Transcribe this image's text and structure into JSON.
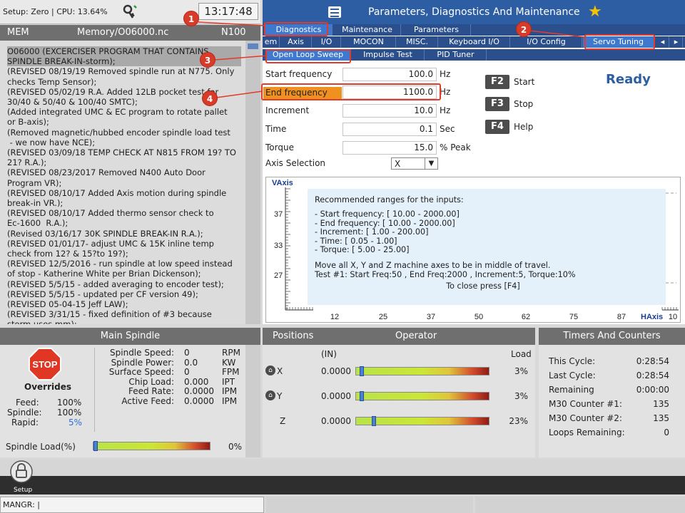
{
  "status": {
    "text": "Setup: Zero | CPU: 13.64%",
    "clock": "13:17:48"
  },
  "program": {
    "mode": "MEM",
    "path": "Memory/O06000.nc",
    "line": "N100",
    "lines": [
      "O06000 (EXCERCISER PROGRAM THAT CONTAINS",
      "SPINDLE BREAK-IN-storm);",
      "(REVISED 08/19/19 Removed spindle run at N775. Only",
      "checks Temp Sensor);",
      "(REVISED 05/02/19 R.A. Added 12LB pocket test for",
      "30/40 & 50/40 & 100/40 SMTC);",
      "(Added integrated UMC & EC program to rotate pallet",
      "or B-axis);",
      "(Removed magnetic/hubbed encoder spindle load test",
      " - we now have NCE);",
      "(REVISED 03/09/18 TEMP CHECK AT N815 FROM 19? TO",
      "21? R.A.);",
      "(REVISED 08/23/2017 Removed N400 Auto Door",
      "Program VR);",
      "(REVISED 08/10/17 Added Axis motion during spindle",
      "break-in VR.);",
      "(REVISED 08/10/17 Added thermo sensor check to",
      "Ec-1600  R.A.);",
      "(Revised 03/16/17 30K SPINDLE BREAK-IN R.A.);",
      "(REVISED 01/01/17- adjust UMC & 15K inline temp",
      "check from 12? & 15?to 19?);",
      "(REVISED 12/5/2016 - run spindle at low speed instead",
      "of stop - Katherine White per Brian Dickenson);",
      "(REVISED 5/5/15 - added averaging to encoder test);",
      "(REVISED 5/5/15 - updated per CF version 49);",
      "(REVISED 05-04-15 Jeff LAW);",
      "(REVISED 3/31/15 - fixed definition of #3 because",
      "storm uses mm);"
    ]
  },
  "right": {
    "title": "Parameters, Diagnostics And Maintenance",
    "tabs1": [
      "Diagnostics",
      "Maintenance",
      "Parameters"
    ],
    "tabs2": [
      "em",
      "Axis",
      "I/O",
      "MOCON",
      "MISC.",
      "Keyboard I/O",
      "I/O Config",
      "Servo Tuning"
    ],
    "tabs3": [
      "Open Loop Sweep",
      "Impulse Test",
      "PID Tuner"
    ],
    "params": [
      {
        "label": "Start frequency",
        "value": "100.0",
        "unit": "Hz"
      },
      {
        "label": "End frequency",
        "value": "1100.0",
        "unit": "Hz"
      },
      {
        "label": "Increment",
        "value": "10.0",
        "unit": "Hz"
      },
      {
        "label": "Time",
        "value": "0.1",
        "unit": "Sec"
      },
      {
        "label": "Torque",
        "value": "15.0",
        "unit": "% Peak"
      }
    ],
    "axis_label": "Axis Selection",
    "axis_value": "X",
    "fkeys": [
      {
        "key": "F2",
        "label": "Start"
      },
      {
        "key": "F3",
        "label": "Stop"
      },
      {
        "key": "F4",
        "label": "Help"
      }
    ],
    "ready": "Ready",
    "callouts": [
      "1",
      "2",
      "3",
      "4"
    ],
    "graph": {
      "ylabel": "VAxis",
      "xlabel": "HAxis",
      "yticks": [
        "37",
        "33",
        "27"
      ],
      "xticks": [
        "12",
        "25",
        "37",
        "50",
        "62",
        "75",
        "87",
        "10"
      ]
    },
    "help": {
      "title": "Recommended ranges for the inputs:",
      "lines": [
        "- Start frequency: [ 10.00 - 2000.00]",
        "- End frequency: [ 10.00 - 2000.00]",
        "- Increment: [ 1.00 - 200.00]",
        "- Time: [ 0.05 - 1.00]",
        "- Torque: [ 5.00 - 25.00]"
      ],
      "move": "Move all X, Y and Z machine axes to be in middle of travel.",
      "test": "Test #1: Start Freq:50 , End Freq:2000 , Increment:5, Torque:10%",
      "close": "To close press [F4]"
    }
  },
  "spindle": {
    "title": "Main Spindle",
    "stop": "STOP",
    "overrides": "Overrides",
    "ov": [
      {
        "label": "Feed:",
        "value": "100%"
      },
      {
        "label": "Spindle:",
        "value": "100%"
      },
      {
        "label": "Rapid:",
        "value": "5%"
      }
    ],
    "stats": [
      {
        "label": "Spindle Speed:",
        "value": "0",
        "unit": "RPM"
      },
      {
        "label": "Spindle Power:",
        "value": "0.0",
        "unit": "KW"
      },
      {
        "label": "Surface Speed:",
        "value": "0",
        "unit": "FPM"
      },
      {
        "label": "Chip Load:",
        "value": "0.000",
        "unit": "IPT"
      },
      {
        "label": "Feed Rate:",
        "value": "0.0000",
        "unit": "IPM"
      },
      {
        "label": "Active Feed:",
        "value": "0.0000",
        "unit": "IPM"
      }
    ],
    "load_label": "Spindle Load(%)",
    "load_value": "0%",
    "load_fraction": 0.0
  },
  "positions": {
    "title": "Positions",
    "subtitle": "Operator",
    "unit": "(IN)",
    "load": "Load",
    "axes": [
      {
        "axis": "X",
        "value": "0.0000",
        "load": "3%",
        "load_fraction": 0.03
      },
      {
        "axis": "Y",
        "value": "0.0000",
        "load": "3%",
        "load_fraction": 0.03
      },
      {
        "axis": "Z",
        "value": "0.0000",
        "load": "23%",
        "load_fraction": 0.12
      }
    ]
  },
  "timers": {
    "title": "Timers And Counters",
    "rows": [
      {
        "label": "This Cycle:",
        "value": "0:28:54"
      },
      {
        "label": "Last Cycle:",
        "value": "0:28:54"
      },
      {
        "label": "Remaining",
        "value": "0:00:00"
      },
      {
        "label": "M30 Counter #1:",
        "value": "135"
      },
      {
        "label": "M30 Counter #2:",
        "value": "135"
      },
      {
        "label": "Loops Remaining:",
        "value": "0"
      }
    ]
  },
  "footer": {
    "setup": "Setup",
    "cmd": "MANGR: |"
  },
  "colors": {
    "accent": "#2d5ea4",
    "highlight": "#f0901e",
    "callout": "#d93b2b"
  }
}
